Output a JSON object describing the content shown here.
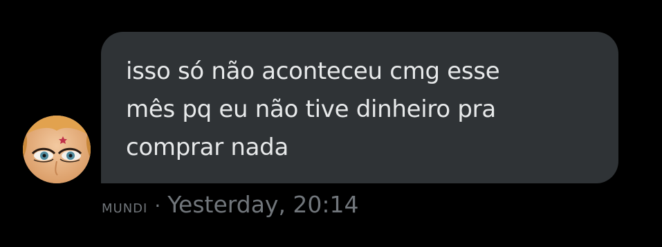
{
  "message": {
    "text": "isso só não aconteceu cmg esse\nmês pq eu não tive dinheiro pra\ncomprar nada",
    "sender": "MUNDI",
    "separator": "·",
    "timestamp": "Yesterday, 20:14"
  },
  "avatar": {
    "icon": "user-avatar-photo"
  },
  "colors": {
    "background": "#000000",
    "bubble": "#2f3336",
    "text": "#e7e9ea",
    "meta": "#71767b"
  }
}
